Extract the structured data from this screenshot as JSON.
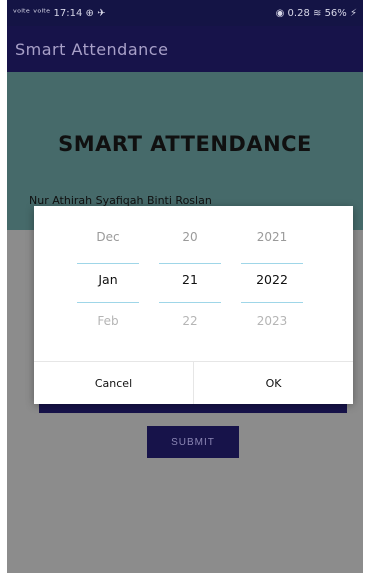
{
  "statusbar": {
    "left": "ᵛᵒˡᵗᵉ ᵛᵒˡᵗᵉ 17:14 ⊕ ✈",
    "right": "◉ 0.28 ≋ 56% ⚡"
  },
  "appbar": {
    "title": "Smart Attendance"
  },
  "header": {
    "title": "SMART ATTENDANCE",
    "name": "Nur Athirah Syafiqah Binti Roslan"
  },
  "content": {
    "submit_label": "SUBMIT"
  },
  "date_picker": {
    "month": {
      "prev": "Dec",
      "current": "Jan",
      "next": "Feb"
    },
    "day": {
      "prev": "20",
      "current": "21",
      "next": "22"
    },
    "year": {
      "prev": "2021",
      "current": "2022",
      "next": "2023"
    },
    "cancel_label": "Cancel",
    "ok_label": "OK"
  }
}
